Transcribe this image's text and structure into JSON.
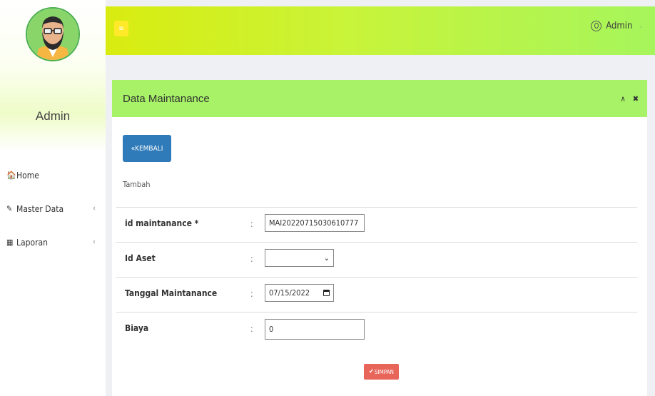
{
  "sidebar": {
    "profile_name": "Admin",
    "menu": [
      {
        "icon": "home-icon",
        "glyph": "🏠",
        "label": "Home",
        "has_submenu": false
      },
      {
        "icon": "edit-icon",
        "glyph": "✎",
        "label": "Master Data",
        "has_submenu": true
      },
      {
        "icon": "calendar-icon",
        "glyph": "▦",
        "label": "Laporan",
        "has_submenu": true
      }
    ],
    "submenu_arrow": "‹"
  },
  "header": {
    "menu_icon": "≡",
    "user_label": "Admin",
    "user_caret": "⌄"
  },
  "panel": {
    "title": "Data Maintanance",
    "collapse_icon": "∧",
    "close_icon": "✖",
    "back_button": "KEMBALI",
    "back_icon": "«",
    "subtitle": "Tambah",
    "fields": [
      {
        "label": "id maintanance *",
        "value": "MAI20220715030610777"
      },
      {
        "label": "Id Aset",
        "value": ""
      },
      {
        "label": "Tanggal Maintanance",
        "value": "07/15/2022"
      },
      {
        "label": "Biaya",
        "value": "0"
      }
    ],
    "colon": ":",
    "select_caret": "⌄",
    "save_button": "SIMPAN",
    "save_icon": "✔"
  },
  "colors": {
    "header_gradient_start": "#d9ec10",
    "header_gradient_end": "#a6f55c",
    "panel_head": "#a7f266",
    "back_button": "#2f7bb9",
    "save_button": "#e8655a"
  }
}
